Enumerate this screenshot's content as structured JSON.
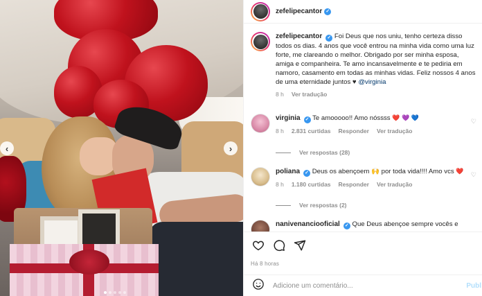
{
  "post": {
    "username": "zefelipecantor",
    "caption": "Foi Deus que nos uniu, tenho certeza disso todos os dias. 4 anos que você entrou na minha vida como uma luz forte, me clareando o melhor. Obrigado por ser minha esposa, amiga e companheira. Te amo incansavelmente e te pediria em namoro, casamento em todas as minhas vidas. Feliz nossos 4 anos de uma eternidade juntos ♥",
    "caption_mention": "@virginia",
    "time": "8 h",
    "see_translation": "Ver tradução",
    "posted_ago": "Há 8 horas"
  },
  "comments": [
    {
      "username": "virginia",
      "text": "Te amooooo!! Amo nóssss",
      "hearts": "❤️ 💜 💙",
      "time": "8 h",
      "likes": "2.831 curtidas",
      "reply": "Responder",
      "translate": "Ver tradução",
      "view_replies": "Ver respostas (28)"
    },
    {
      "username": "poliana",
      "text": "Deus os abençoem 🙌 por toda vida!!!! Amo vcs",
      "hearts": "❤️",
      "time": "8 h",
      "likes": "1.180 curtidas",
      "reply": "Responder",
      "translate": "Ver tradução",
      "view_replies": "Ver respostas (2)"
    },
    {
      "username": "nanivenanciooficial",
      "text": "Que Deus abençoe sempre vocês e"
    }
  ],
  "add_comment": {
    "placeholder": "Adicione um comentário...",
    "publish_label": "Publ"
  },
  "icons": {
    "like": "heart-icon",
    "comment": "comment-icon",
    "share": "share-icon",
    "emoji": "emoji-icon",
    "prev": "chevron-left-icon",
    "next": "chevron-right-icon"
  },
  "colors": {
    "verified": "#3897f0",
    "link": "#00376b",
    "secondary_text": "#8e8e8e"
  }
}
